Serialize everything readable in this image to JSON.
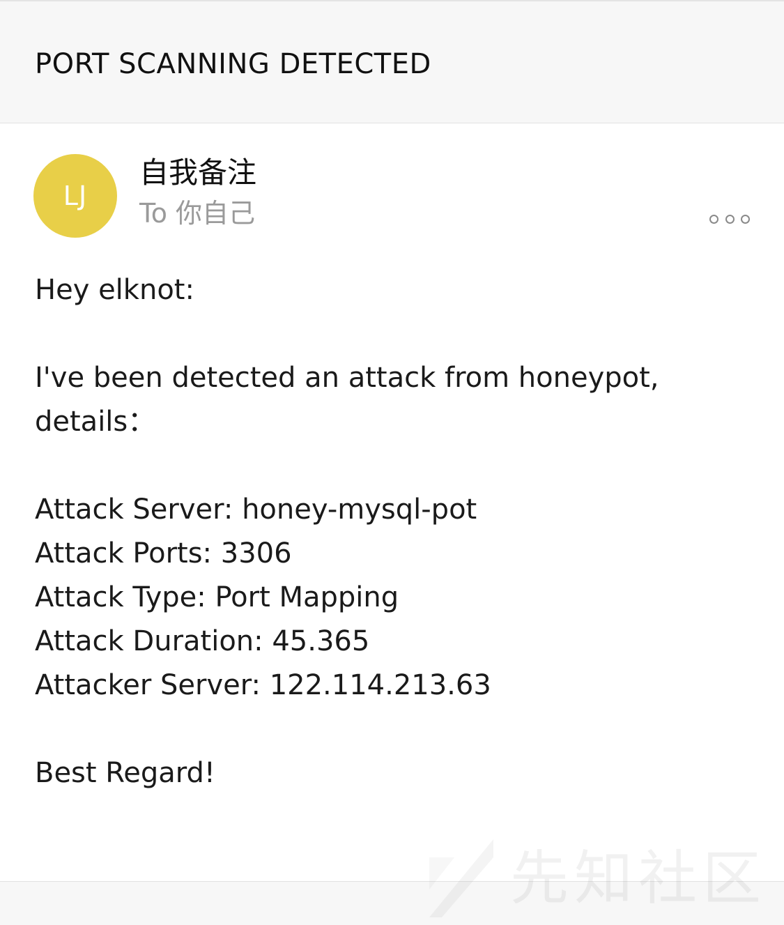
{
  "subject": "PORT SCANNING DETECTED",
  "sender": {
    "avatar_initials": "LJ",
    "name": "自我备注",
    "to_label": "To",
    "recipient": "你自己"
  },
  "colors": {
    "avatar_background": "#e8cf48",
    "header_background": "#f7f7f7",
    "recipient_text": "#9a9a9a"
  },
  "icons": {
    "more": "more-options-icon"
  },
  "body": {
    "greeting": "Hey elknot:",
    "intro_line1": "I've been detected an attack from honeypot,",
    "intro_line2": "details：",
    "details": [
      "Attack Server: honey-mysql-pot",
      "Attack Ports: 3306",
      "Attack Type: Port Mapping",
      "Attack Duration: 45.365",
      "Attacker Server: 122.114.213.63"
    ],
    "closing": "Best Regard!"
  },
  "watermark": {
    "text": "先知社区"
  }
}
